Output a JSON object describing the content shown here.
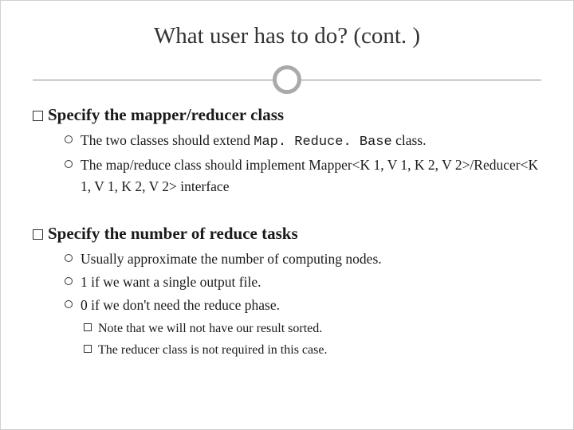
{
  "title": "What user has to do? (cont. )",
  "section1": {
    "heading": "Specify the mapper/reducer class",
    "items": [
      {
        "prefix": "The two classes should extend ",
        "code": "Map. Reduce. Base",
        "suffix": " class."
      },
      {
        "text": "The map/reduce class should implement Mapper<K 1, V 1, K 2, V 2>/Reducer<K 1, V 1, K 2, V 2> interface"
      }
    ]
  },
  "section2": {
    "heading": "Specify the number of reduce tasks",
    "items": [
      {
        "text": "Usually approximate the number of computing nodes."
      },
      {
        "text": "1 if we want a single output file."
      },
      {
        "text": "0 if we don't need the reduce phase."
      }
    ],
    "notes": [
      {
        "text": "Note that we will not have our result sorted."
      },
      {
        "text": "The reducer class is not required in this case."
      }
    ]
  }
}
